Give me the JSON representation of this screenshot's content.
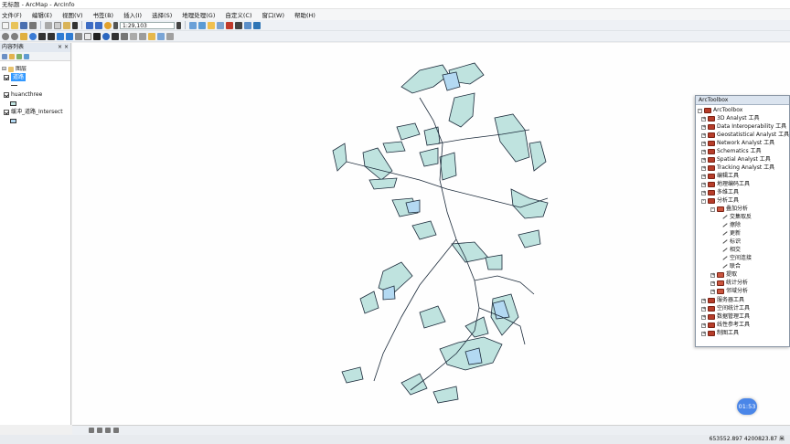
{
  "window": {
    "title": "无标题 - ArcMap - ArcInfo"
  },
  "menu": [
    "文件(F)",
    "编辑(E)",
    "视图(V)",
    "书签(B)",
    "插入(I)",
    "选择(S)",
    "地理处理(G)",
    "自定义(C)",
    "窗口(W)",
    "帮助(H)"
  ],
  "toolbar": {
    "scale": "1:29,103"
  },
  "toc": {
    "title": "内容列表",
    "layers_group": "图层",
    "layers": [
      {
        "name": "道路",
        "selected": true
      },
      {
        "name": "huancthree",
        "selected": false
      },
      {
        "name": "缓冲_道路_Intersect",
        "selected": false
      }
    ]
  },
  "arctoolbox": {
    "title": "ArcToolbox",
    "root": "ArcToolbox",
    "toolboxes": [
      "3D Analyst 工具",
      "Data Interoperability 工具",
      "Geostatistical Analyst 工具",
      "Network Analyst 工具",
      "Schematics 工具",
      "Spatial Analyst 工具",
      "Tracking Analyst 工具",
      "编辑工具",
      "地理编码工具",
      "多维工具",
      "分析工具"
    ],
    "overlay_toolset": "叠加分析",
    "overlay_tools": [
      "交集取反",
      "擦除",
      "更新",
      "标识",
      "相交",
      "空间连接",
      "联合"
    ],
    "other_toolsets": [
      "提取",
      "统计分析",
      "邻域分析"
    ],
    "toolboxes_after": [
      "服务器工具",
      "空间统计工具",
      "数据管理工具",
      "线性参考工具",
      "制图工具"
    ]
  },
  "status": {
    "coordinates": "653552.897  4200823.87 米"
  },
  "timer": "01:53",
  "colors": {
    "polygon_fill": "#bfe3df",
    "water_fill": "#b3d9f2",
    "line": "#1b2a3a"
  }
}
